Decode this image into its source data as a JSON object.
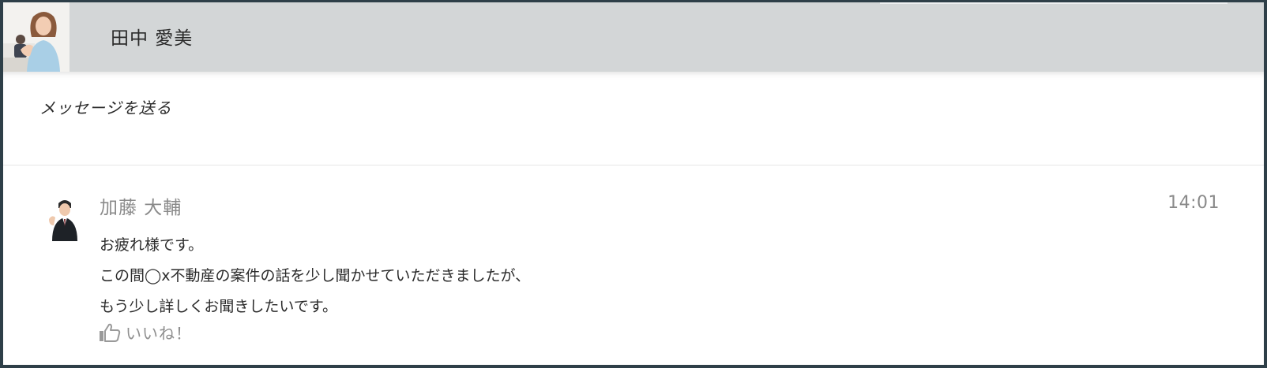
{
  "header": {
    "user_name": "田中 愛美",
    "avatar_icon": "user-avatar-icon"
  },
  "compose": {
    "placeholder": "メッセージを送る"
  },
  "message": {
    "author": "加藤 大輔",
    "time": "14:01",
    "lines": [
      "お疲れ様です。",
      "この間◯x不動産の案件の話を少し聞かせていただきましたが、",
      "もう少し詳しくお聞きしたいです。"
    ],
    "like_label": "いいね！",
    "like_icon": "thumbs-up-icon"
  },
  "colors": {
    "header_bg": "#d3d6d7",
    "frame": "#2e3f48",
    "muted_text": "#8a8a8a"
  }
}
